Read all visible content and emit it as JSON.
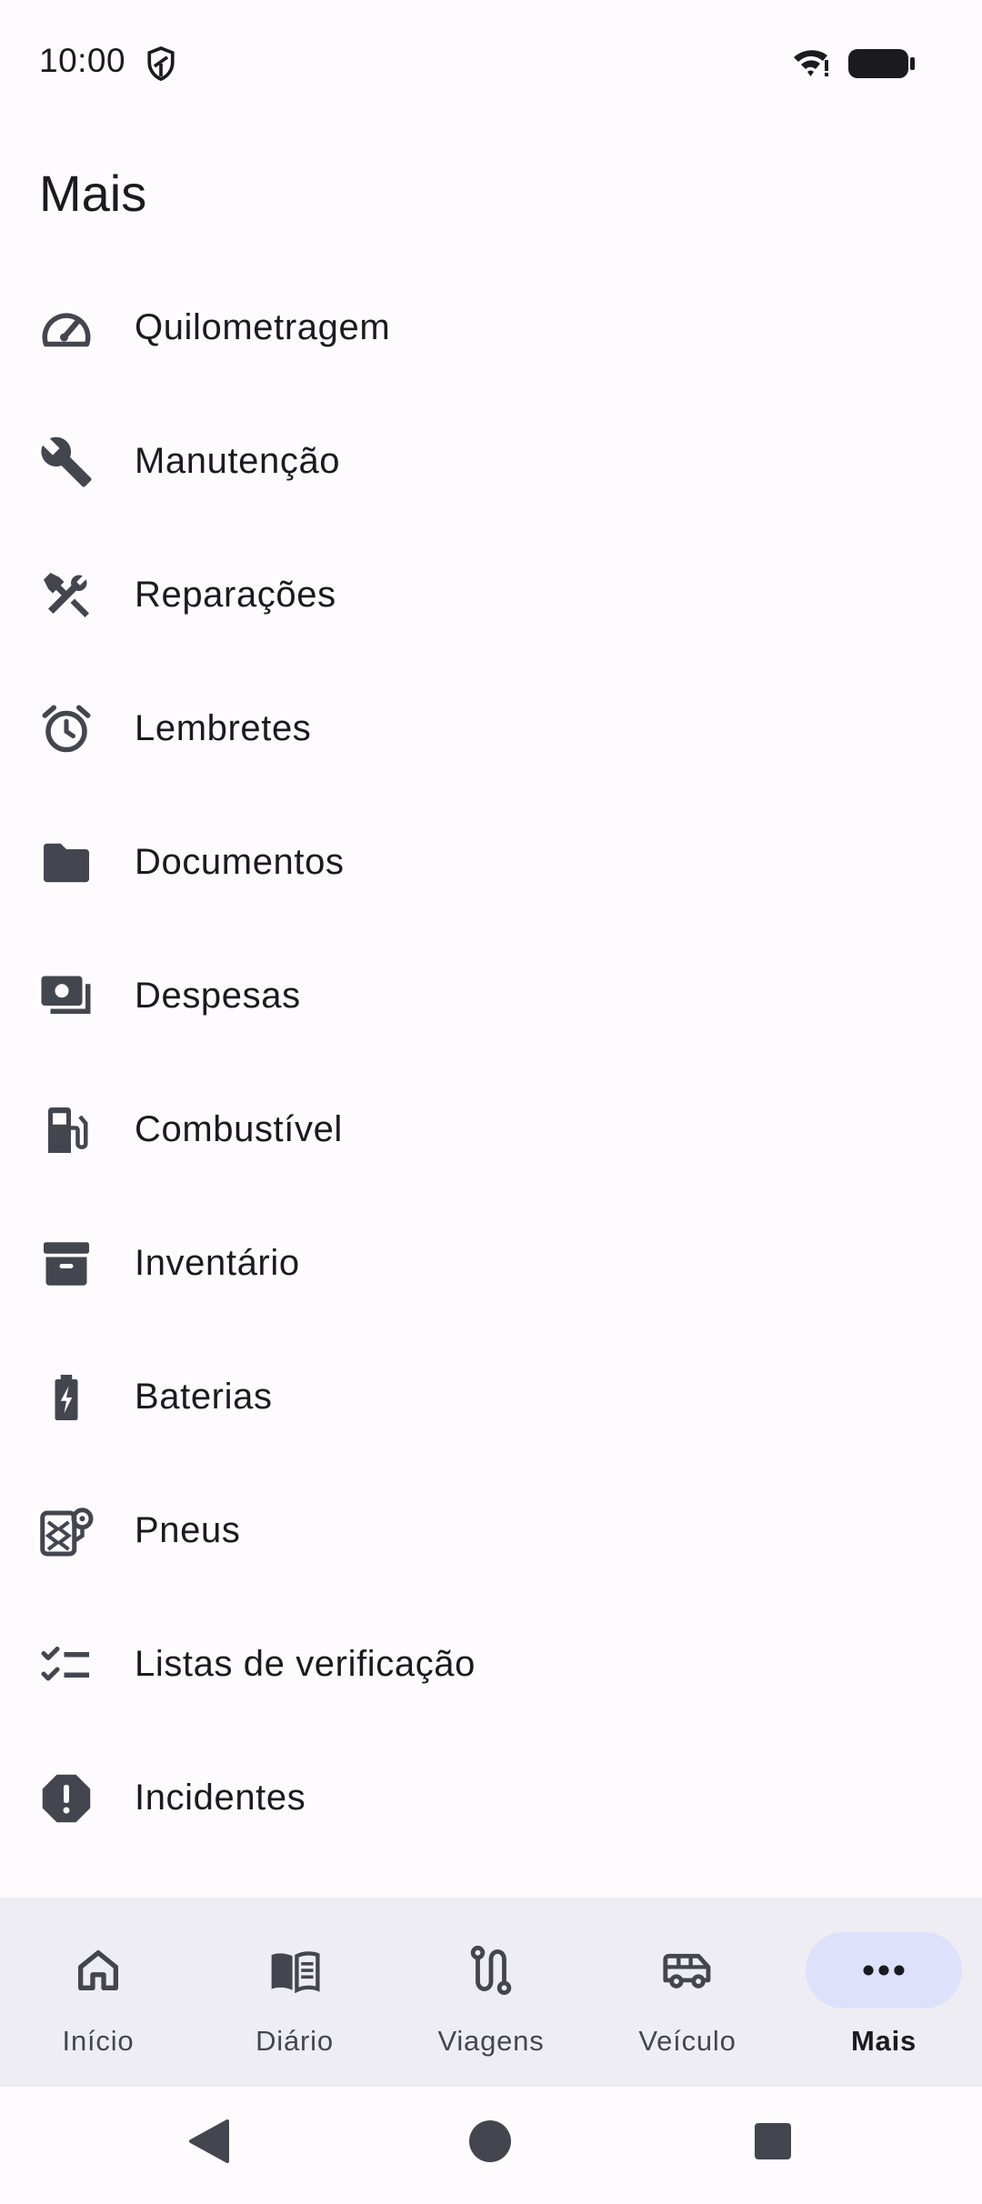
{
  "status_bar": {
    "time": "10:00",
    "icons": [
      "shield-icon",
      "wifi-icon",
      "battery-icon"
    ]
  },
  "page": {
    "title": "Mais"
  },
  "menu": {
    "items": [
      {
        "label": "Quilometragem",
        "icon": "speedometer-icon"
      },
      {
        "label": "Manutenção",
        "icon": "wrench-icon"
      },
      {
        "label": "Reparações",
        "icon": "hammer-wrench-icon"
      },
      {
        "label": "Lembretes",
        "icon": "alarm-icon"
      },
      {
        "label": "Documentos",
        "icon": "folder-icon"
      },
      {
        "label": "Despesas",
        "icon": "money-icon"
      },
      {
        "label": "Combustível",
        "icon": "fuel-icon"
      },
      {
        "label": "Inventário",
        "icon": "archive-icon"
      },
      {
        "label": "Baterias",
        "icon": "battery-charging-icon"
      },
      {
        "label": "Pneus",
        "icon": "tire-icon"
      },
      {
        "label": "Listas de verificação",
        "icon": "checklist-icon"
      },
      {
        "label": "Incidentes",
        "icon": "alert-octagon-icon"
      }
    ]
  },
  "bottom_nav": {
    "items": [
      {
        "label": "Início",
        "icon": "home-icon",
        "active": false
      },
      {
        "label": "Diário",
        "icon": "book-icon",
        "active": false
      },
      {
        "label": "Viagens",
        "icon": "route-icon",
        "active": false
      },
      {
        "label": "Veículo",
        "icon": "van-icon",
        "active": false
      },
      {
        "label": "Mais",
        "icon": "more-horiz-icon",
        "active": true
      }
    ]
  },
  "system_nav": {
    "buttons": [
      "back-icon",
      "home-circle-icon",
      "recents-icon"
    ]
  },
  "colors": {
    "background": "#fdfbfe",
    "nav_bar": "#efedf4",
    "active_pill": "#dde1f9",
    "icon": "#44464f",
    "text": "#1b1b1f"
  }
}
